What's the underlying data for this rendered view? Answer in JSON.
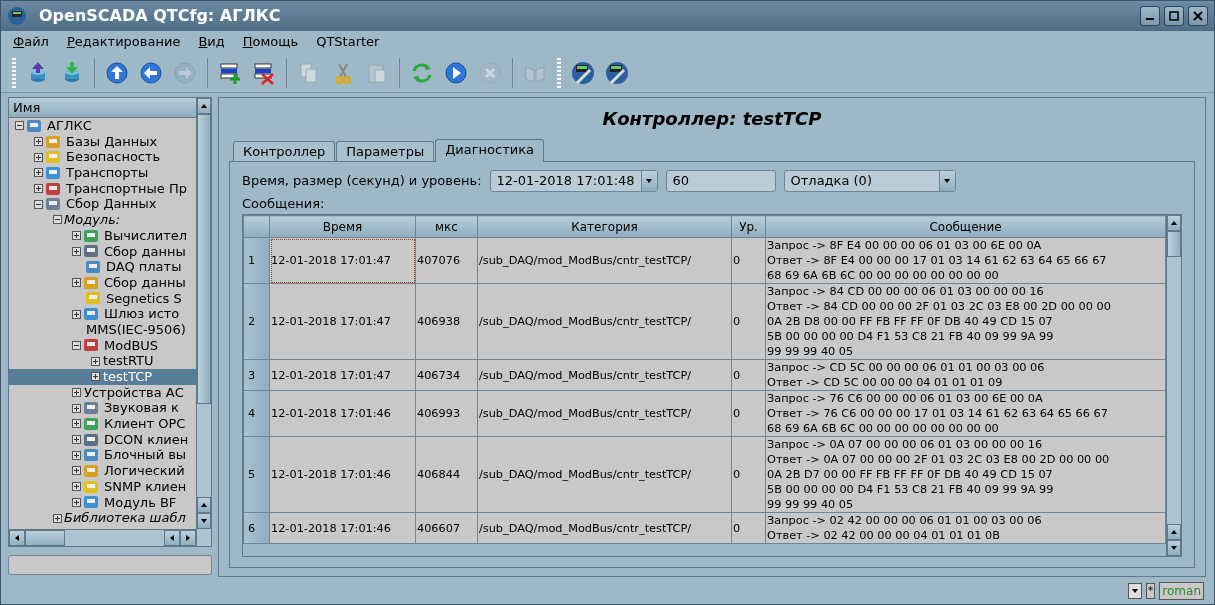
{
  "window": {
    "title": "OpenSCADA QTCfg: АГЛКС"
  },
  "menu": [
    {
      "label": "Файл",
      "underlined_first": true
    },
    {
      "label": "Редактирование",
      "underlined_first": true
    },
    {
      "label": "Вид",
      "underlined_first": true
    },
    {
      "label": "Помощь",
      "underlined_first": true
    },
    {
      "label": "QTStarter",
      "underlined_first": false
    }
  ],
  "toolbar": [
    {
      "kind": "grip"
    },
    {
      "kind": "dbload",
      "disabled": false
    },
    {
      "kind": "dbsave",
      "disabled": false
    },
    {
      "kind": "sep"
    },
    {
      "kind": "up",
      "disabled": false
    },
    {
      "kind": "back",
      "disabled": false
    },
    {
      "kind": "forward",
      "disabled": true
    },
    {
      "kind": "sep"
    },
    {
      "kind": "add",
      "disabled": false
    },
    {
      "kind": "remove",
      "disabled": false
    },
    {
      "kind": "sep"
    },
    {
      "kind": "copy",
      "disabled": true
    },
    {
      "kind": "cut",
      "disabled": false
    },
    {
      "kind": "paste",
      "disabled": true
    },
    {
      "kind": "sep"
    },
    {
      "kind": "refresh",
      "disabled": false
    },
    {
      "kind": "start",
      "disabled": false
    },
    {
      "kind": "stop",
      "disabled": true
    },
    {
      "kind": "sep"
    },
    {
      "kind": "book",
      "disabled": true
    },
    {
      "kind": "grip"
    },
    {
      "kind": "tool",
      "disabled": false
    },
    {
      "kind": "tool",
      "disabled": false
    }
  ],
  "tree": {
    "header": "Имя",
    "items": [
      {
        "label": "АГЛКС",
        "kind": "item",
        "expanded": true,
        "selected": false,
        "children": [
          {
            "label": "Базы Данных",
            "kind": "item",
            "expanded": false,
            "selected": false
          },
          {
            "label": "Безопасность",
            "kind": "item",
            "expanded": false,
            "selected": false
          },
          {
            "label": "Транспорты",
            "kind": "item",
            "expanded": false,
            "selected": false
          },
          {
            "label": "Транспортные Пр",
            "kind": "item",
            "expanded": false,
            "selected": false
          },
          {
            "label": "Сбор Данных",
            "kind": "item",
            "expanded": true,
            "selected": false,
            "children": [
              {
                "label": "Модуль:",
                "kind": "group",
                "expanded": true,
                "selected": false,
                "children": [
                  {
                    "label": "Вычислител",
                    "kind": "item",
                    "expanded": false,
                    "selected": false
                  },
                  {
                    "label": "Сбор данны",
                    "kind": "item",
                    "expanded": false,
                    "selected": false
                  },
                  {
                    "label": "DAQ платы",
                    "kind": "item",
                    "selected": false
                  },
                  {
                    "label": "Сбор данны",
                    "kind": "item",
                    "expanded": false,
                    "selected": false
                  },
                  {
                    "label": "Segnetics S",
                    "kind": "item",
                    "selected": false
                  },
                  {
                    "label": "Шлюз исто",
                    "kind": "item",
                    "expanded": false,
                    "selected": false
                  },
                  {
                    "label": "MMS(IEC-9506)",
                    "kind": "plain",
                    "selected": false
                  },
                  {
                    "label": "ModBUS",
                    "kind": "item",
                    "expanded": true,
                    "selected": false,
                    "children": [
                      {
                        "label": "testRTU",
                        "kind": "plain",
                        "expanded": false,
                        "selected": false
                      },
                      {
                        "label": "testTCP",
                        "kind": "plain",
                        "expanded": false,
                        "selected": true
                      }
                    ]
                  },
                  {
                    "label": "Устройства АС",
                    "kind": "plain",
                    "expanded": false,
                    "selected": false
                  },
                  {
                    "label": "Звуковая к",
                    "kind": "item",
                    "expanded": false,
                    "selected": false
                  },
                  {
                    "label": "Клиент OPC",
                    "kind": "item",
                    "expanded": false,
                    "selected": false
                  },
                  {
                    "label": "DCON клиен",
                    "kind": "item",
                    "expanded": false,
                    "selected": false
                  },
                  {
                    "label": "Блочный вы",
                    "kind": "item",
                    "expanded": false,
                    "selected": false
                  },
                  {
                    "label": "Логический",
                    "kind": "item",
                    "expanded": false,
                    "selected": false
                  },
                  {
                    "label": "SNMP клиен",
                    "kind": "item",
                    "expanded": false,
                    "selected": false
                  },
                  {
                    "label": "Модуль BF",
                    "kind": "item",
                    "expanded": false,
                    "selected": false
                  }
                ]
              },
              {
                "label": "Библиотека шабл",
                "kind": "group",
                "expanded": false,
                "selected": false
              }
            ]
          }
        ]
      }
    ]
  },
  "page": {
    "title": "Контроллер: testTCP",
    "tabs": [
      {
        "label": "Контроллер",
        "selected": false
      },
      {
        "label": "Параметры",
        "selected": false
      },
      {
        "label": "Диагностика",
        "selected": true
      }
    ],
    "filter_label": "Время, размер (секунд) и уровень:",
    "time": "12-01-2018 17:01:48",
    "size": "60",
    "level": "Отладка (0)",
    "messages_label": "Сообщения:",
    "table": {
      "columns": [
        "Время",
        "мкс",
        "Категория",
        "Ур.",
        "Сообщение"
      ],
      "rows": [
        {
          "num": "1",
          "time": "12-01-2018 17:01:47",
          "us": "407076",
          "category": "/sub_DAQ/mod_ModBus/cntr_testTCP/",
          "level": "0",
          "focused": true,
          "message": [
            "Запрос -> 8F E4 00 00 00 06 01 03 00 6E 00 0A",
            "Ответ -> 8F E4 00 00 00 17 01 03 14 61 62 63 64 65 66 67",
            "68 69 6A 6B 6C 00 00 00 00 00 00 00 00"
          ]
        },
        {
          "num": "2",
          "time": "12-01-2018 17:01:47",
          "us": "406938",
          "category": "/sub_DAQ/mod_ModBus/cntr_testTCP/",
          "level": "0",
          "focused": false,
          "message": [
            "Запрос -> 84 CD 00 00 00 06 01 03 00 00 00 16",
            "Ответ -> 84 CD 00 00 00 2F 01 03 2C 03 E8 00 2D 00 00 00",
            "0A 2B D8 00 00 FF FB FF FF 0F DB 40 49 CD 15 07",
            "5B 00 00 00 00 D4 F1 53 C8 21 FB 40 09 99 9A 99",
            "99 99 99 40 05"
          ]
        },
        {
          "num": "3",
          "time": "12-01-2018 17:01:47",
          "us": "406734",
          "category": "/sub_DAQ/mod_ModBus/cntr_testTCP/",
          "level": "0",
          "focused": false,
          "message": [
            "Запрос -> CD 5C 00 00 00 06 01 01 00 03 00 06",
            "Ответ -> CD 5C 00 00 00 04 01 01 01 09"
          ]
        },
        {
          "num": "4",
          "time": "12-01-2018 17:01:46",
          "us": "406993",
          "category": "/sub_DAQ/mod_ModBus/cntr_testTCP/",
          "level": "0",
          "focused": false,
          "message": [
            "Запрос -> 76 C6 00 00 00 06 01 03 00 6E 00 0A",
            "Ответ -> 76 C6 00 00 00 17 01 03 14 61 62 63 64 65 66 67",
            "68 69 6A 6B 6C 00 00 00 00 00 00 00 00"
          ]
        },
        {
          "num": "5",
          "time": "12-01-2018 17:01:46",
          "us": "406844",
          "category": "/sub_DAQ/mod_ModBus/cntr_testTCP/",
          "level": "0",
          "focused": false,
          "message": [
            "Запрос -> 0A 07 00 00 00 06 01 03 00 00 00 16",
            "Ответ -> 0A 07 00 00 00 2F 01 03 2C 03 E8 00 2D 00 00 00",
            "0A 2B D7 00 00 FF FB FF FF 0F DB 40 49 CD 15 07",
            "5B 00 00 00 00 D4 F1 53 C8 21 FB 40 09 99 9A 99",
            "99 99 99 40 05"
          ]
        },
        {
          "num": "6",
          "time": "12-01-2018 17:01:46",
          "us": "406607",
          "category": "/sub_DAQ/mod_ModBus/cntr_testTCP/",
          "level": "0",
          "focused": false,
          "message": [
            "Запрос -> 02 42 00 00 00 06 01 01 00 03 00 06",
            "Ответ -> 02 42 00 00 00 04 01 01 01 0B"
          ]
        }
      ]
    }
  },
  "status_bar": {
    "star": "*",
    "user": "roman"
  }
}
